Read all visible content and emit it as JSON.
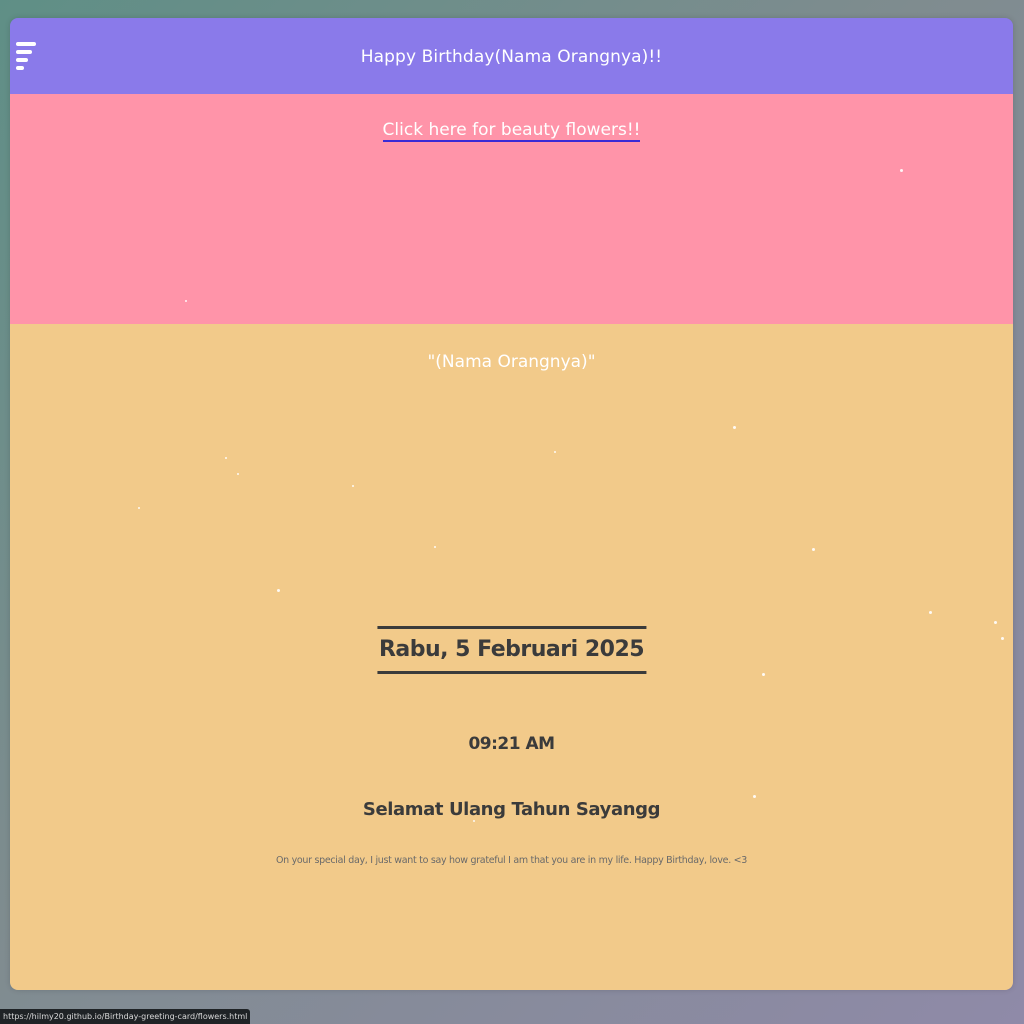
{
  "colors": {
    "topbar": "#8a7aea",
    "pink": "#ff94a9",
    "gold": "#f2ca8a",
    "text_dark": "#3b3b3b",
    "link_underline": "#3a2bd6"
  },
  "topbar": {
    "menu_icon": "hamburger-menu-icon",
    "title": "Happy Birthday(Nama Orangnya)!!"
  },
  "pink_section": {
    "link_text": "Click here for beauty flowers!!"
  },
  "gold_section": {
    "name_title": "\"(Nama Orangnya)\"",
    "date": "Rabu, 5 Februari 2025",
    "time": "09:21 AM",
    "greeting": "Selamat Ulang Tahun Sayangg",
    "message": "On your special day, I just want to say how grateful I am that you are in my life. Happy Birthday, love. <3"
  },
  "status_bar": {
    "url": "https://hilmy20.github.io/Birthday-greeting-card/flowers.html"
  }
}
